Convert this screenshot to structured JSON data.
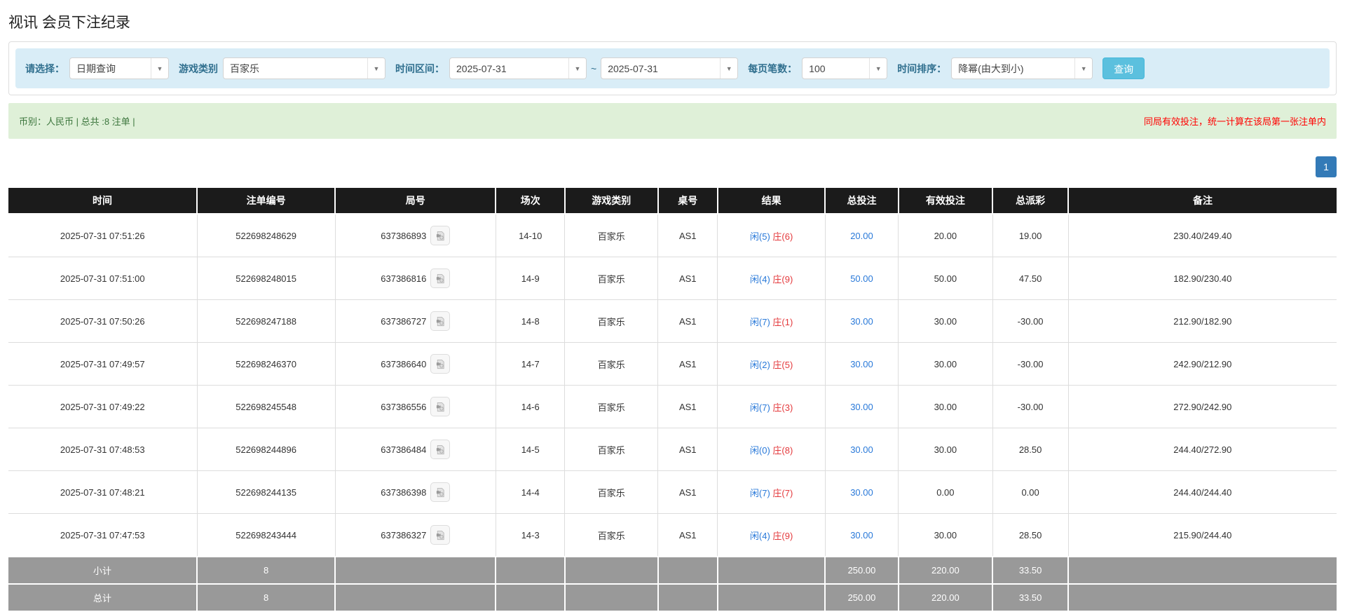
{
  "page": {
    "title": "视讯 会员下注纪录"
  },
  "colors": {
    "accent_blue": "#2979d9",
    "negative_red": "#e4393c",
    "header_bg": "#1b1b1b",
    "summary_bg": "#999999",
    "filter_bg": "#d9edf7",
    "filter_label": "#31708f",
    "alert_bg": "#dff0d8",
    "alert_text": "#3c763d",
    "alert_warning": "#ff0000",
    "button_bg": "#5bc0de",
    "page_active": "#337ab7"
  },
  "filters": {
    "select_label": "请选择：",
    "select_value": "日期查询",
    "game_label": "游戏类别",
    "game_value": "百家乐",
    "range_label": "时间区间：",
    "date_from": "2025-07-31",
    "range_separator": "~",
    "date_to": "2025-07-31",
    "page_size_label": "每页笔数：",
    "page_size_value": "100",
    "sort_label": "时间排序：",
    "sort_value": "降幂(由大到小)",
    "search_button": "查询"
  },
  "summary_bar": {
    "left_text": "币别：人民币 | 总共 :8 注单 |",
    "right_text": "同局有效投注，统一计算在该局第一张注单内"
  },
  "pagination": {
    "current_page": "1"
  },
  "table": {
    "columns": [
      "时间",
      "注单编号",
      "局号",
      "场次",
      "游戏类别",
      "桌号",
      "结果",
      "总投注",
      "有效投注",
      "总派彩",
      "备注"
    ],
    "rows": [
      {
        "time": "2025-07-31 07:51:26",
        "bet_id": "522698248629",
        "round": "637386893",
        "session": "14-10",
        "game": "百家乐",
        "table_no": "AS1",
        "result_player": "闲(5)",
        "result_banker": "庄(6)",
        "total_bet": "20.00",
        "valid_bet": "20.00",
        "payout": "19.00",
        "remark": "230.40/249.40"
      },
      {
        "time": "2025-07-31 07:51:00",
        "bet_id": "522698248015",
        "round": "637386816",
        "session": "14-9",
        "game": "百家乐",
        "table_no": "AS1",
        "result_player": "闲(4)",
        "result_banker": "庄(9)",
        "total_bet": "50.00",
        "valid_bet": "50.00",
        "payout": "47.50",
        "remark": "182.90/230.40"
      },
      {
        "time": "2025-07-31 07:50:26",
        "bet_id": "522698247188",
        "round": "637386727",
        "session": "14-8",
        "game": "百家乐",
        "table_no": "AS1",
        "result_player": "闲(7)",
        "result_banker": "庄(1)",
        "total_bet": "30.00",
        "valid_bet": "30.00",
        "payout": "-30.00",
        "remark": "212.90/182.90"
      },
      {
        "time": "2025-07-31 07:49:57",
        "bet_id": "522698246370",
        "round": "637386640",
        "session": "14-7",
        "game": "百家乐",
        "table_no": "AS1",
        "result_player": "闲(2)",
        "result_banker": "庄(5)",
        "total_bet": "30.00",
        "valid_bet": "30.00",
        "payout": "-30.00",
        "remark": "242.90/212.90"
      },
      {
        "time": "2025-07-31 07:49:22",
        "bet_id": "522698245548",
        "round": "637386556",
        "session": "14-6",
        "game": "百家乐",
        "table_no": "AS1",
        "result_player": "闲(7)",
        "result_banker": "庄(3)",
        "total_bet": "30.00",
        "valid_bet": "30.00",
        "payout": "-30.00",
        "remark": "272.90/242.90"
      },
      {
        "time": "2025-07-31 07:48:53",
        "bet_id": "522698244896",
        "round": "637386484",
        "session": "14-5",
        "game": "百家乐",
        "table_no": "AS1",
        "result_player": "闲(0)",
        "result_banker": "庄(8)",
        "total_bet": "30.00",
        "valid_bet": "30.00",
        "payout": "28.50",
        "remark": "244.40/272.90"
      },
      {
        "time": "2025-07-31 07:48:21",
        "bet_id": "522698244135",
        "round": "637386398",
        "session": "14-4",
        "game": "百家乐",
        "table_no": "AS1",
        "result_player": "闲(7)",
        "result_banker": "庄(7)",
        "total_bet": "30.00",
        "valid_bet": "0.00",
        "payout": "0.00",
        "remark": "244.40/244.40"
      },
      {
        "time": "2025-07-31 07:47:53",
        "bet_id": "522698243444",
        "round": "637386327",
        "session": "14-3",
        "game": "百家乐",
        "table_no": "AS1",
        "result_player": "闲(4)",
        "result_banker": "庄(9)",
        "total_bet": "30.00",
        "valid_bet": "30.00",
        "payout": "28.50",
        "remark": "215.90/244.40"
      }
    ],
    "subtotal": {
      "label": "小计",
      "count": "8",
      "total_bet": "250.00",
      "valid_bet": "220.00",
      "payout": "33.50"
    },
    "total": {
      "label": "总计",
      "count": "8",
      "total_bet": "250.00",
      "valid_bet": "220.00",
      "payout": "33.50"
    }
  }
}
